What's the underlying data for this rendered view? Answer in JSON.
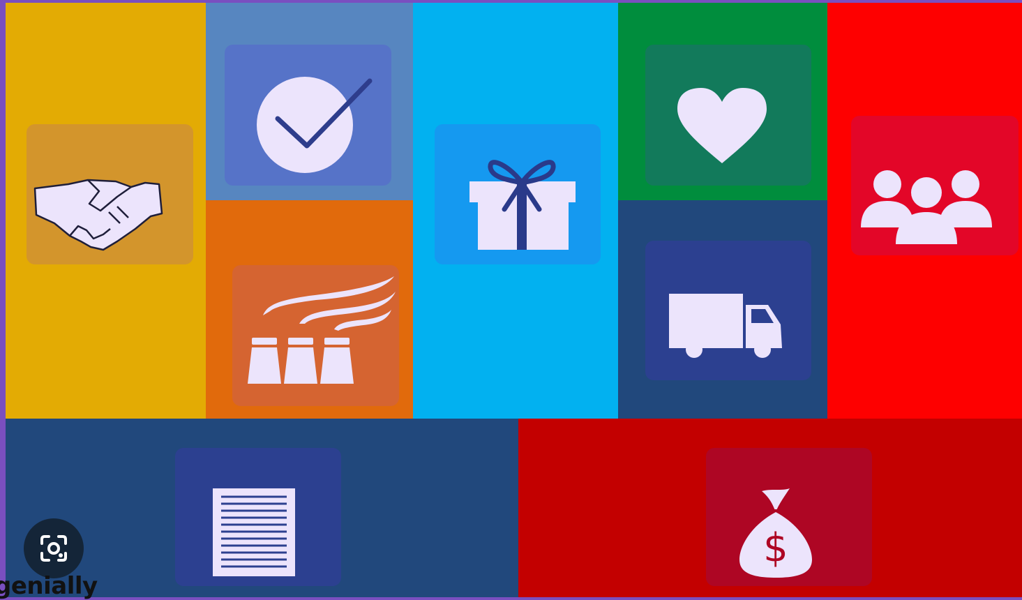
{
  "colors": {
    "frame": "#7a4fc0",
    "partnership": "#e3ab04",
    "quality": "#5786c0",
    "production": "#e16a0c",
    "gifts": "#02b1f0",
    "health": "#008d3d",
    "logistics": "#21487c",
    "community": "#fe0000",
    "documents": "#21487c",
    "finance": "#c30000",
    "icon_fill": "#ece4fc"
  },
  "icons": [
    "handshake-icon",
    "checkmark-circle-icon",
    "factory-icon",
    "gift-icon",
    "heart-icon",
    "truck-icon",
    "group-icon",
    "document-icon",
    "money-bag-icon",
    "lens-search-icon"
  ],
  "watermark": {
    "brand": "genially"
  }
}
